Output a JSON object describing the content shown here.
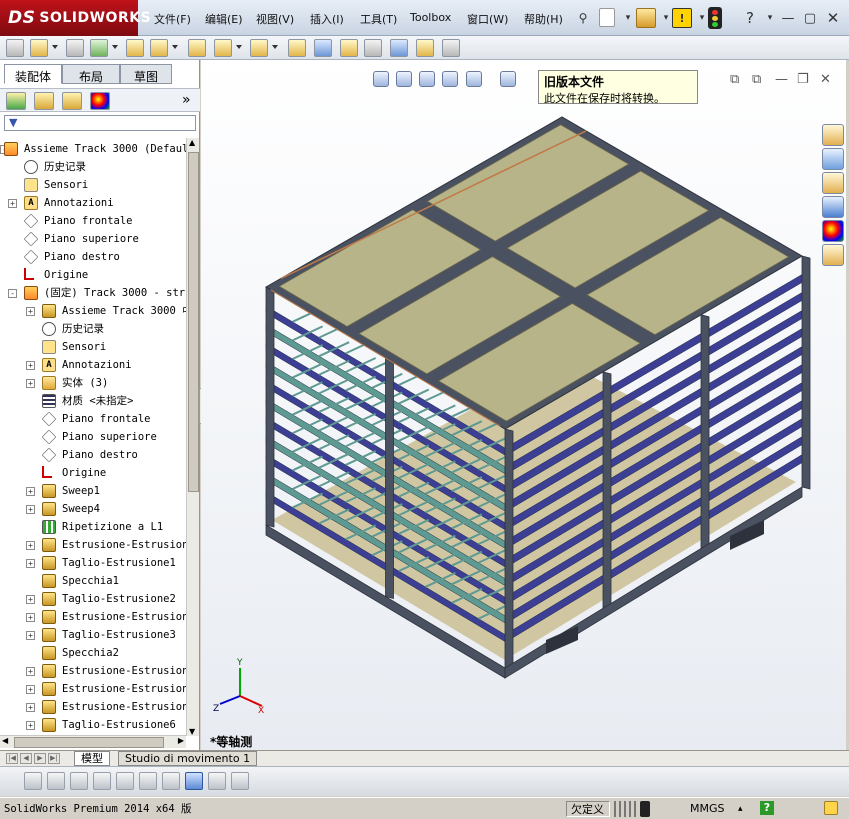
{
  "app": {
    "logo_ds": "DS",
    "logo_name": "SOLIDWORKS"
  },
  "menu": {
    "items": [
      "文件(F)",
      "编辑(E)",
      "视图(V)",
      "插入(I)",
      "工具(T)",
      "Toolbox",
      "窗口(W)",
      "帮助(H)"
    ]
  },
  "feature_manager": {
    "tabs": [
      "装配体",
      "布局",
      "草图"
    ],
    "tree": [
      {
        "label": "Assieme Track 3000  (Defaul",
        "icon": "assembly",
        "indent": 0,
        "expander": "-"
      },
      {
        "label": "历史记录",
        "icon": "history",
        "indent": 1,
        "expander": ""
      },
      {
        "label": "Sensori",
        "icon": "sensor",
        "indent": 1,
        "expander": ""
      },
      {
        "label": "Annotazioni",
        "icon": "anno",
        "indent": 1,
        "expander": "+"
      },
      {
        "label": "Piano frontale",
        "icon": "plane",
        "indent": 1,
        "expander": ""
      },
      {
        "label": "Piano superiore",
        "icon": "plane",
        "indent": 1,
        "expander": ""
      },
      {
        "label": "Piano destro",
        "icon": "plane",
        "indent": 1,
        "expander": ""
      },
      {
        "label": "Origine",
        "icon": "origin",
        "indent": 1,
        "expander": ""
      },
      {
        "label": "(固定) Track 3000 - stru",
        "icon": "assembly",
        "indent": 1,
        "expander": "-"
      },
      {
        "label": "Assieme Track 3000 中",
        "icon": "feature",
        "indent": 2,
        "expander": "+"
      },
      {
        "label": "历史记录",
        "icon": "history",
        "indent": 2,
        "expander": ""
      },
      {
        "label": "Sensori",
        "icon": "sensor",
        "indent": 2,
        "expander": ""
      },
      {
        "label": "Annotazioni",
        "icon": "anno",
        "indent": 2,
        "expander": "+"
      },
      {
        "label": "实体 (3)",
        "icon": "folder",
        "indent": 2,
        "expander": "+"
      },
      {
        "label": "材质 <未指定>",
        "icon": "material",
        "indent": 2,
        "expander": ""
      },
      {
        "label": "Piano frontale",
        "icon": "plane",
        "indent": 2,
        "expander": ""
      },
      {
        "label": "Piano superiore",
        "icon": "plane",
        "indent": 2,
        "expander": ""
      },
      {
        "label": "Piano destro",
        "icon": "plane",
        "indent": 2,
        "expander": ""
      },
      {
        "label": "Origine",
        "icon": "origin",
        "indent": 2,
        "expander": ""
      },
      {
        "label": "Sweep1",
        "icon": "feature",
        "indent": 2,
        "expander": "+"
      },
      {
        "label": "Sweep4",
        "icon": "feature",
        "indent": 2,
        "expander": "+"
      },
      {
        "label": "Ripetizione a L1",
        "icon": "pattern",
        "indent": 2,
        "expander": ""
      },
      {
        "label": "Estrusione-Estrusion",
        "icon": "feature",
        "indent": 2,
        "expander": "+"
      },
      {
        "label": "Taglio-Estrusione1",
        "icon": "feature",
        "indent": 2,
        "expander": "+"
      },
      {
        "label": "Specchia1",
        "icon": "feature",
        "indent": 2,
        "expander": ""
      },
      {
        "label": "Taglio-Estrusione2",
        "icon": "feature",
        "indent": 2,
        "expander": "+"
      },
      {
        "label": "Estrusione-Estrusion",
        "icon": "feature",
        "indent": 2,
        "expander": "+"
      },
      {
        "label": "Taglio-Estrusione3",
        "icon": "feature",
        "indent": 2,
        "expander": "+"
      },
      {
        "label": "Specchia2",
        "icon": "feature",
        "indent": 2,
        "expander": ""
      },
      {
        "label": "Estrusione-Estrusion",
        "icon": "feature",
        "indent": 2,
        "expander": "+"
      },
      {
        "label": "Estrusione-Estrusion",
        "icon": "feature",
        "indent": 2,
        "expander": "+"
      },
      {
        "label": "Estrusione-Estrusion",
        "icon": "feature",
        "indent": 2,
        "expander": "+"
      },
      {
        "label": "Taglio-Estrusione6",
        "icon": "feature",
        "indent": 2,
        "expander": "+"
      }
    ]
  },
  "viewport": {
    "tooltip_title": "旧版本文件",
    "tooltip_body": "此文件在保存时将转换。",
    "view_name": "*等轴测",
    "triad": {
      "x": "X",
      "y": "Y",
      "z": "Z"
    }
  },
  "bottom_tabs": [
    "模型",
    "Studio di movimento 1"
  ],
  "status": {
    "product": "SolidWorks Premium 2014 x64 版",
    "definition": "欠定义",
    "units": "MMGS",
    "help": "?"
  },
  "colors": {
    "frame": "#4a5160",
    "frame_dark": "#2d323c",
    "panel_top": "#b8b48a",
    "rail_blue": "#3c3f93",
    "rail_green": "#5f9a92",
    "floor": "#d0c7a2",
    "copper": "#c07a46"
  }
}
